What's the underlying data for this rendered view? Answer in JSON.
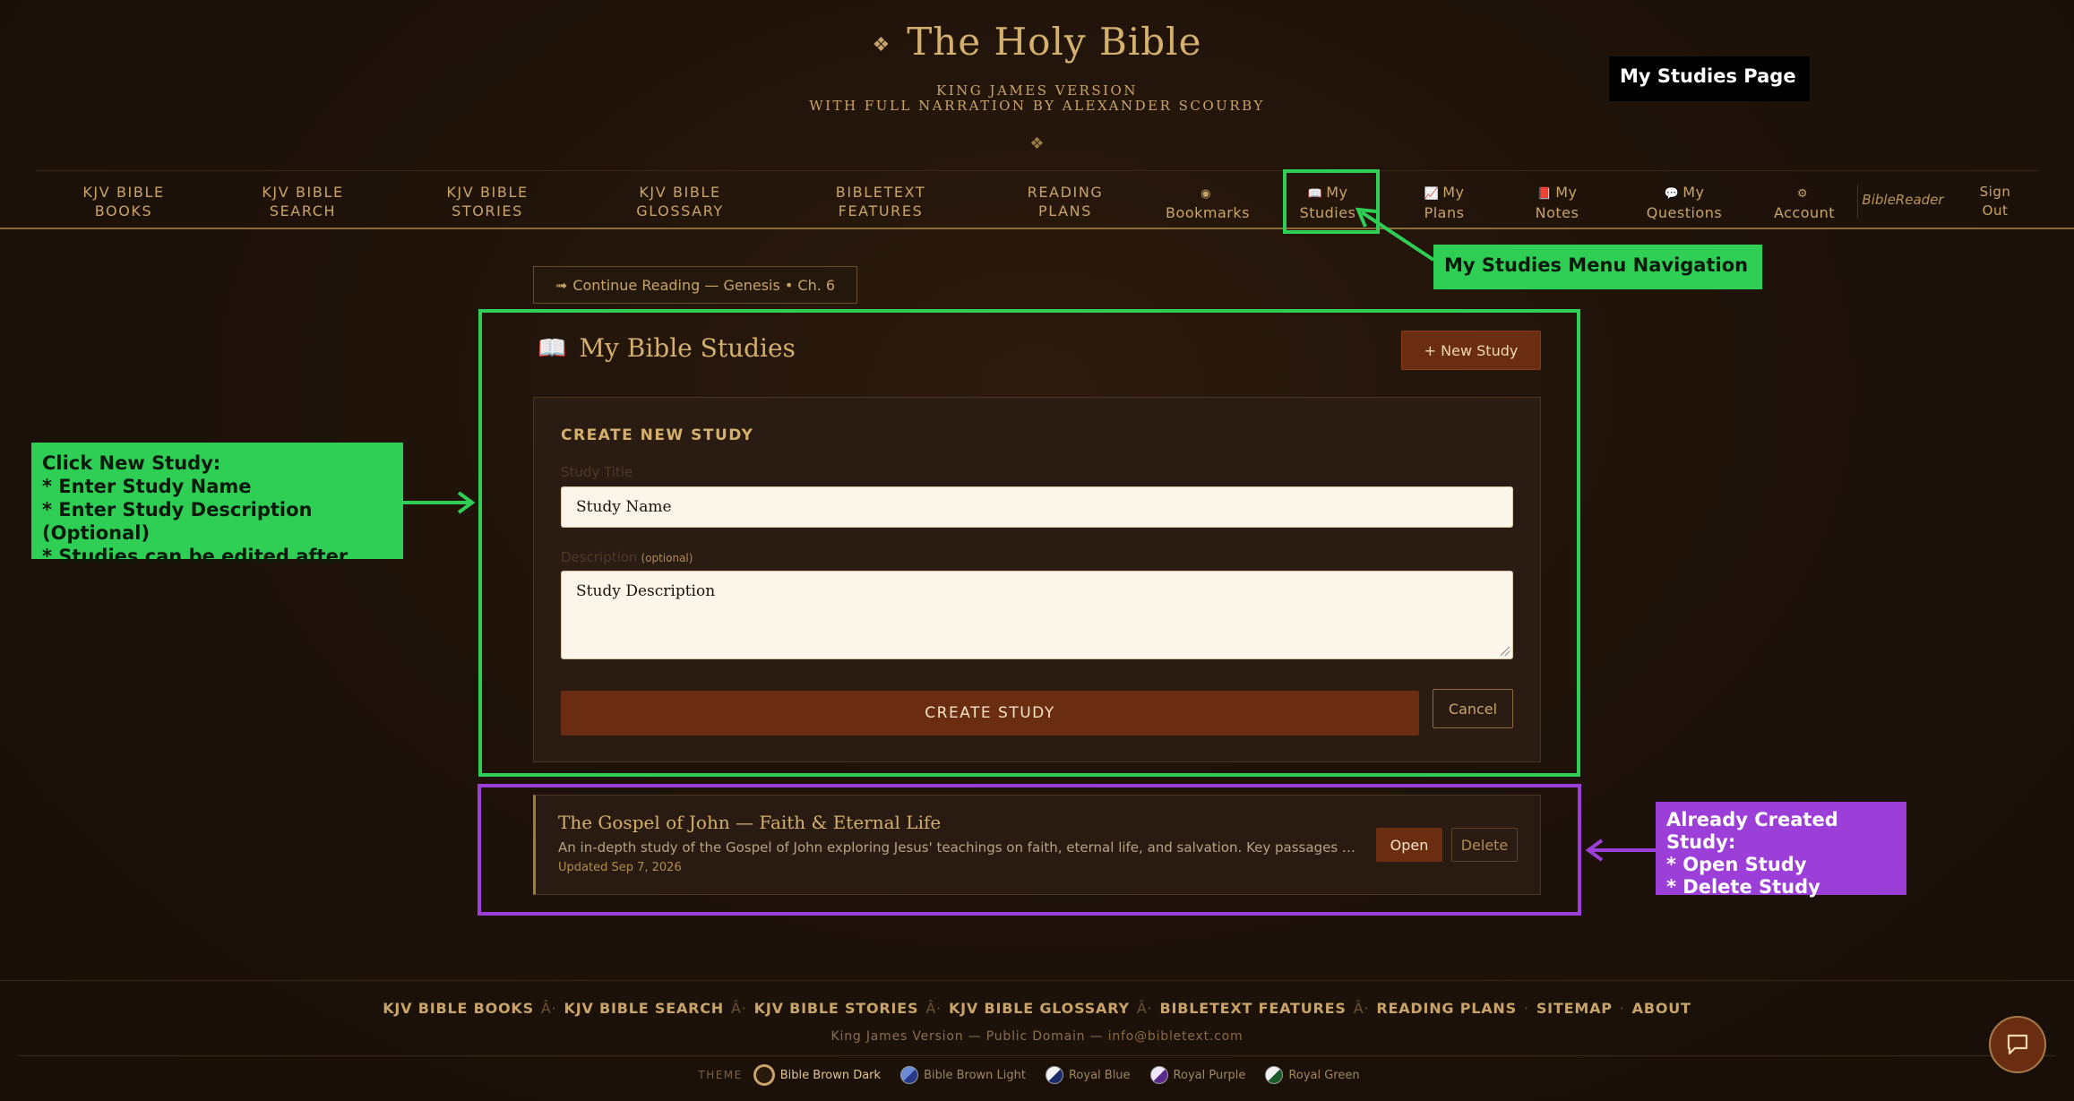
{
  "header": {
    "ornament": "❖",
    "title": "The Holy Bible",
    "subtitle_1": "KING JAMES VERSION",
    "subtitle_2": "WITH FULL NARRATION BY ALEXANDER SCOURBY",
    "divider": "❖"
  },
  "nav": {
    "items": [
      {
        "line1": "KJV BIBLE",
        "line2": "BOOKS"
      },
      {
        "line1": "KJV BIBLE",
        "line2": "SEARCH"
      },
      {
        "line1": "KJV BIBLE",
        "line2": "STORIES"
      },
      {
        "line1": "KJV BIBLE",
        "line2": "GLOSSARY"
      },
      {
        "line1": "BIBLETEXT",
        "line2": "FEATURES"
      },
      {
        "line1": "READING",
        "line2": "PLANS"
      },
      {
        "icon": "◉",
        "line2": "Bookmarks"
      },
      {
        "icon": "📖",
        "line1": "My",
        "line2": "Studies"
      },
      {
        "icon": "📈",
        "line1": "My",
        "line2": "Plans"
      },
      {
        "icon": "📕",
        "line1": "My",
        "line2": "Notes"
      },
      {
        "icon": "💬",
        "line1": "My",
        "line2": "Questions"
      },
      {
        "icon": "⚙",
        "line2": "Account"
      }
    ],
    "brand": "BibleReader",
    "signout_line1": "Sign",
    "signout_line2": "Out"
  },
  "annotations": {
    "page_label": "My Studies Page",
    "nav_label": "My Studies Menu Navigation",
    "new_study": [
      "Click New Study:",
      "* Enter Study Name",
      "* Enter Study Description (Optional)",
      "* Studies can be edited after"
    ],
    "existing_study": [
      "Already Created Study:",
      "* Open Study",
      "* Delete Study"
    ],
    "colors": {
      "green": "#2fcf55",
      "purple": "#9b3fd8",
      "black": "#000000"
    }
  },
  "continue_reading": {
    "icon": "➟",
    "label": "Continue Reading — Genesis • Ch. 6"
  },
  "studies_panel": {
    "icon": "📖",
    "title": "My Bible Studies",
    "new_study_label": "+ New Study",
    "create_form": {
      "heading": "CREATE NEW STUDY",
      "title_label": "Study Title",
      "title_value": "Study Name",
      "desc_label": "Description",
      "desc_optional": "(optional)",
      "desc_value": "Study Description",
      "create_label": "CREATE STUDY",
      "cancel_label": "Cancel"
    }
  },
  "studies": [
    {
      "title": "The Gospel of John — Faith & Eternal Life",
      "description": "An in-depth study of the Gospel of John exploring Jesus' teachings on faith, eternal life, and salvation. Key passages inclu...",
      "updated": "Updated Sep 7, 2026",
      "open_label": "Open",
      "delete_label": "Delete"
    }
  ],
  "footer": {
    "links": [
      "KJV BIBLE BOOKS",
      "KJV BIBLE SEARCH",
      "KJV BIBLE STORIES",
      "KJV BIBLE GLOSSARY",
      "BIBLETEXT FEATURES",
      "READING PLANS",
      "SITEMAP",
      "ABOUT"
    ],
    "link_sep": "Â·",
    "dot_sep": "·",
    "copyright": "King James Version — Public Domain — ",
    "email": "info@bibletext.com",
    "theme_label": "THEME",
    "themes": [
      "Bible Brown Dark",
      "Bible Brown Light",
      "Royal Blue",
      "Royal Purple",
      "Royal Green"
    ],
    "active_theme": "Bible Brown Dark"
  },
  "colors": {
    "background": "#1f130a",
    "gold": "#c8a46a",
    "accent_button": "#6b2d12"
  }
}
